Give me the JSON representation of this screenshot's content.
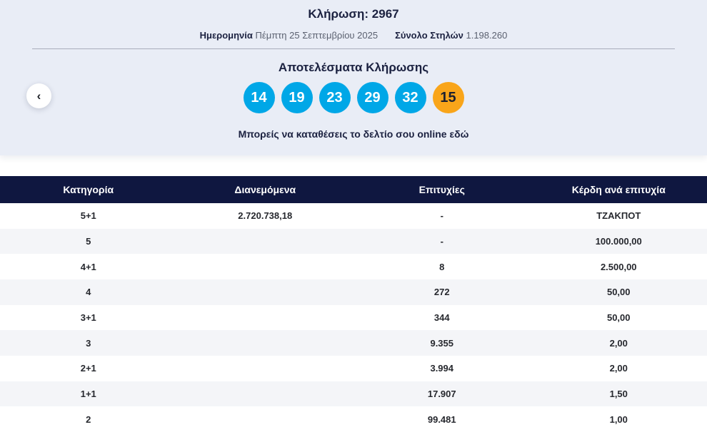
{
  "hero": {
    "draw_title": "Κλήρωση: 2967",
    "date_label": "Ημερομηνία",
    "date_value": "Πέμπτη 25 Σεπτεμβρίου 2025",
    "columns_label": "Σύνολο Στηλών",
    "columns_value": "1.198.260",
    "results_title": "Αποτελέσματα Κλήρωσης",
    "online_text": "Μπορείς να καταθέσεις το δελτίο σου online εδώ",
    "prev_icon": "‹"
  },
  "results": {
    "numbers": [
      "14",
      "19",
      "23",
      "29",
      "32"
    ],
    "joker_number": "15",
    "ball_color": "#00a7e7",
    "joker_color": "#f9a51a"
  },
  "table": {
    "headers": [
      "Κατηγορία",
      "Διανεμόμενα",
      "Επιτυχίες",
      "Κέρδη ανά επιτυχία"
    ],
    "rows": [
      {
        "category": "5+1",
        "distributed": "2.720.738,18",
        "winners": "-",
        "prize": "ΤΖΑΚΠΟΤ"
      },
      {
        "category": "5",
        "distributed": "",
        "winners": "-",
        "prize": "100.000,00"
      },
      {
        "category": "4+1",
        "distributed": "",
        "winners": "8",
        "prize": "2.500,00"
      },
      {
        "category": "4",
        "distributed": "",
        "winners": "272",
        "prize": "50,00"
      },
      {
        "category": "3+1",
        "distributed": "",
        "winners": "344",
        "prize": "50,00"
      },
      {
        "category": "3",
        "distributed": "",
        "winners": "9.355",
        "prize": "2,00"
      },
      {
        "category": "2+1",
        "distributed": "",
        "winners": "3.994",
        "prize": "2,00"
      },
      {
        "category": "1+1",
        "distributed": "",
        "winners": "17.907",
        "prize": "1,50"
      },
      {
        "category": "2",
        "distributed": "",
        "winners": "99.481",
        "prize": "1,00"
      }
    ]
  },
  "colors": {
    "hero_background": "#e9edf6",
    "table_header_background": "#0f1740",
    "alt_row_background": "#f4f5f8",
    "accent_navy": "#1b2140"
  }
}
